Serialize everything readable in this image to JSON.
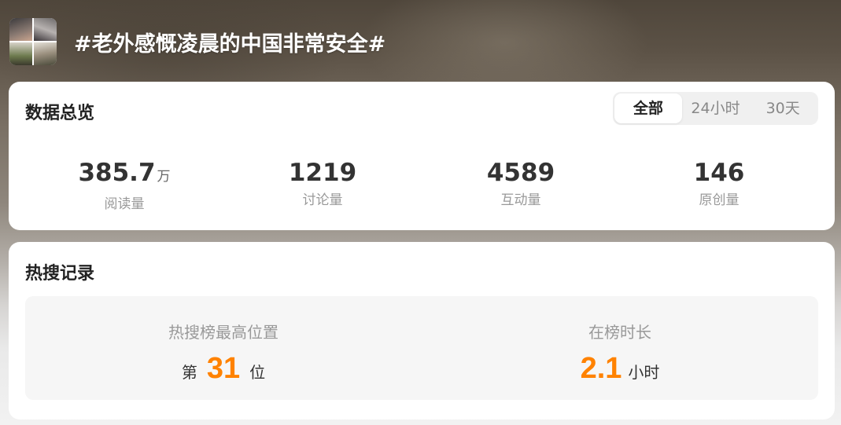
{
  "topic": {
    "title": "#老外感慨凌晨的中国非常安全#"
  },
  "overview": {
    "title": "数据总览",
    "tabs": [
      {
        "label": "全部",
        "active": true
      },
      {
        "label": "24小时",
        "active": false
      },
      {
        "label": "30天",
        "active": false
      }
    ],
    "stats": [
      {
        "value": "385.7",
        "unit": "万",
        "label": "阅读量"
      },
      {
        "value": "1219",
        "unit": "",
        "label": "讨论量"
      },
      {
        "value": "4589",
        "unit": "",
        "label": "互动量"
      },
      {
        "value": "146",
        "unit": "",
        "label": "原创量"
      }
    ]
  },
  "hot_search": {
    "title": "热搜记录",
    "peak_rank": {
      "label": "热搜榜最高位置",
      "prefix": "第",
      "value": "31",
      "suffix": "位"
    },
    "duration": {
      "label": "在榜时长",
      "value": "2.1",
      "suffix": "小时"
    }
  },
  "colors": {
    "accent": "#ff8200",
    "card_bg": "#ffffff",
    "tab_bg": "#f0f0f0"
  }
}
